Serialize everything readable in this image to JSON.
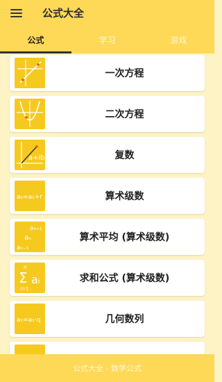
{
  "app": {
    "title": "公式大全"
  },
  "tabs": [
    {
      "label": "公式",
      "active": true
    },
    {
      "label": "学习",
      "active": false
    },
    {
      "label": "游戏",
      "active": false
    }
  ],
  "items": [
    {
      "label": "一次方程",
      "icon": "linear-graph-icon"
    },
    {
      "label": "二次方程",
      "icon": "parabola-graph-icon"
    },
    {
      "label": "复数",
      "icon": "complex-plane-icon"
    },
    {
      "label": "算术级数",
      "icon": "arithmetic-sequence-icon"
    },
    {
      "label": "算术平均 (算术级数)",
      "icon": "arithmetic-mean-icon"
    },
    {
      "label": "求和公式 (算术级数)",
      "icon": "summation-icon"
    },
    {
      "label": "几何数列",
      "icon": "geometric-sequence-icon"
    },
    {
      "label": "",
      "icon": "formula-icon"
    }
  ],
  "thumb_text": {
    "complex": "a+ib",
    "arith": "a₀=a₁+r",
    "mean_top": "aₙ₊₁",
    "mean_mid": "aₙ",
    "mean_bot": "aₙ₋₁",
    "sum_sym": "Σ",
    "sum_n": "n",
    "sum_i": "i=1",
    "sum_a": "aᵢ",
    "geo": "a₂=a₁·q"
  },
  "footer": {
    "text": "公式大全 - 数学公式"
  },
  "colors": {
    "primary": "#fed857",
    "background": "#fdf3c5",
    "thumb": "#f6c91f"
  }
}
